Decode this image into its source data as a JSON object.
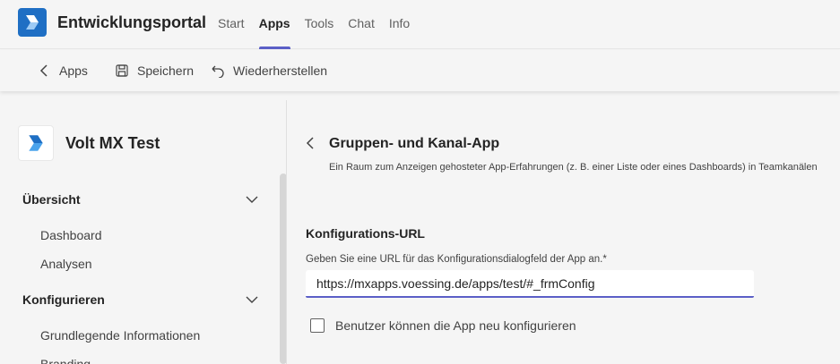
{
  "header": {
    "app_title": "Entwicklungsportal",
    "nav": [
      {
        "label": "Start",
        "active": false
      },
      {
        "label": "Apps",
        "active": true
      },
      {
        "label": "Tools",
        "active": false
      },
      {
        "label": "Chat",
        "active": false
      },
      {
        "label": "Info",
        "active": false
      }
    ]
  },
  "toolbar": {
    "back_label": "Apps",
    "save_label": "Speichern",
    "restore_label": "Wiederherstellen"
  },
  "sidebar": {
    "app_name": "Volt MX Test",
    "sections": [
      {
        "label": "Übersicht",
        "expanded": true,
        "items": [
          "Dashboard",
          "Analysen"
        ]
      },
      {
        "label": "Konfigurieren",
        "expanded": true,
        "items": [
          "Grundlegende Informationen",
          "Branding"
        ]
      }
    ]
  },
  "main": {
    "title": "Gruppen- und Kanal-App",
    "description": "Ein Raum zum Anzeigen gehosteter App-Erfahrungen (z. B. einer Liste oder eines Dashboards) in Teamkanälen",
    "config_section_title": "Konfigurations-URL",
    "config_field_label": "Geben Sie eine URL für das Konfigurationsdialogfeld der App an.*",
    "config_url_value": "https://mxapps.voessing.de/apps/test/#_frmConfig",
    "reconfigure_label": "Benutzer können die App neu konfigurieren",
    "reconfigure_checked": false
  },
  "colors": {
    "accent": "#5b5fc7",
    "app_logo_bg": "#1f6fc4",
    "background": "#f5f5f5"
  },
  "icons": {
    "app_logo": "power-apps-logo-icon",
    "back": "chevron-left-icon",
    "save": "save-icon",
    "restore": "undo-icon",
    "section_toggle": "chevron-down-icon",
    "page_back": "chevron-left-icon"
  }
}
